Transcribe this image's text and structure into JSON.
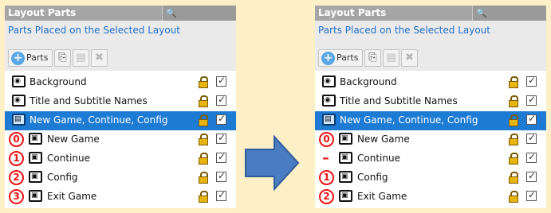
{
  "left_panel": {
    "title": "Layout Parts",
    "subtitle": "Parts Placed on the Selected Layout",
    "toolbar": {
      "parts_label": "Parts"
    },
    "rows": [
      {
        "label": "Background",
        "num": ""
      },
      {
        "label": "Title and Subtitle Names",
        "num": ""
      },
      {
        "label": "New Game, Continue, Config",
        "num": ""
      },
      {
        "label": "New Game",
        "num": "0"
      },
      {
        "label": "Continue",
        "num": "1"
      },
      {
        "label": "Config",
        "num": "2"
      },
      {
        "label": "Exit Game",
        "num": "3"
      }
    ]
  },
  "right_panel": {
    "title": "Layout Parts",
    "subtitle": "Parts Placed on the Selected Layout",
    "toolbar": {
      "parts_label": "Parts"
    },
    "rows": [
      {
        "label": "Background",
        "num": ""
      },
      {
        "label": "Title and Subtitle Names",
        "num": ""
      },
      {
        "label": "New Game, Continue, Config",
        "num": ""
      },
      {
        "label": "New Game",
        "num": "0"
      },
      {
        "label": "Continue",
        "num": "–"
      },
      {
        "label": "Config",
        "num": "1"
      },
      {
        "label": "Exit Game",
        "num": "2"
      }
    ]
  },
  "colors": {
    "background": "#fdf0c6",
    "selection": "#1e7bd4",
    "number_red": "#ee1111",
    "arrow": "#4a7cc2"
  },
  "icons": {
    "search": "search-icon",
    "add": "plus-circle-icon",
    "copy": "copy-icon",
    "paste": "paste-icon",
    "delete": "trash-icon",
    "lock": "lock-icon",
    "check": "checkbox-icon"
  }
}
